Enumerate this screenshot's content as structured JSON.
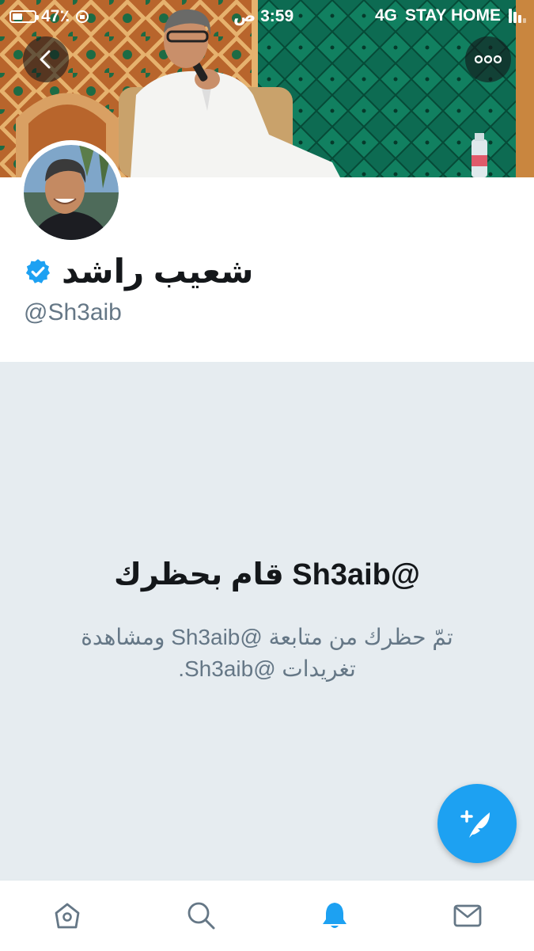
{
  "status_bar": {
    "battery": "47٪",
    "battery_level": 0.47,
    "time": "3:59 ص",
    "network": "4G",
    "carrier": "STAY HOME"
  },
  "header": {
    "back_icon": "chevron-left-icon",
    "more_icon": "more-horizontal-icon"
  },
  "profile": {
    "name": "شعيب راشد",
    "verified": true,
    "handle": "@Sh3aib"
  },
  "blocked": {
    "title": "@Sh3aib قام بحظرك",
    "body": "تمّ حظرك من متابعة @Sh3aib ومشاهدة تغريدات @Sh3aib."
  },
  "fab": {
    "icon": "compose-tweet-icon"
  },
  "tabs": [
    {
      "name": "home",
      "icon": "home-icon"
    },
    {
      "name": "search",
      "icon": "search-icon"
    },
    {
      "name": "notifications",
      "icon": "bell-icon",
      "active": true
    },
    {
      "name": "messages",
      "icon": "mail-icon"
    }
  ],
  "colors": {
    "accent": "#1da1f2",
    "panel_bg": "#e6ecf0",
    "secondary_text": "#657786",
    "icon_inactive": "#657786"
  }
}
